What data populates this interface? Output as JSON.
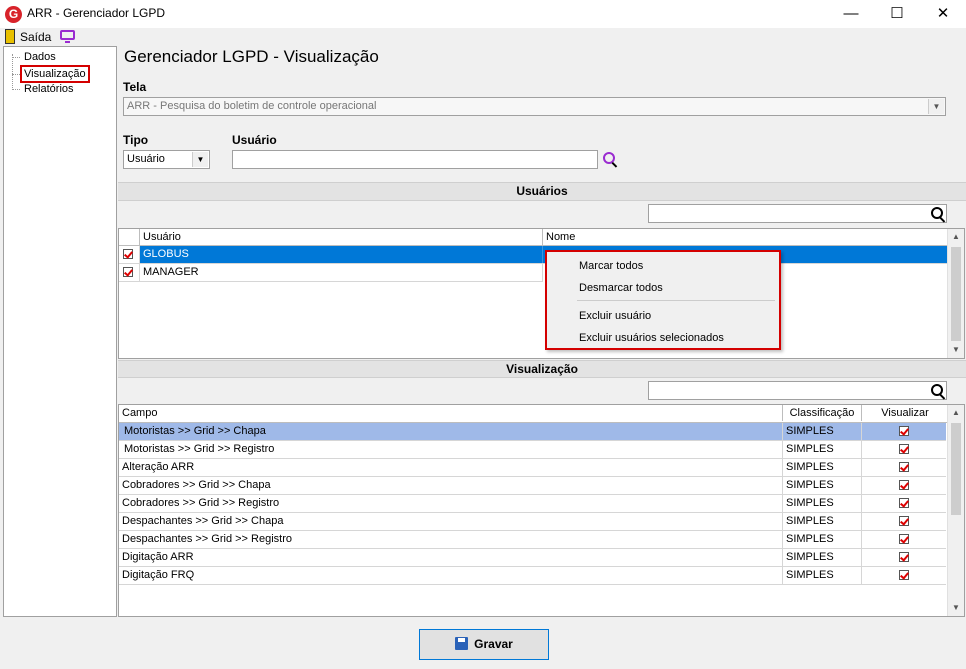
{
  "window": {
    "title": "ARR - Gerenciador LGPD",
    "app_icon_letter": "G",
    "minimize": "—",
    "maximize": "☐",
    "close": "✕"
  },
  "toolbar": {
    "exit_label": "Saída"
  },
  "tree": {
    "items": [
      "Dados",
      "Visualização",
      "Relatórios"
    ],
    "selected": "Visualização"
  },
  "main": {
    "title": "Gerenciador LGPD - Visualização",
    "tela_label": "Tela",
    "tela_value": "ARR - Pesquisa do boletim de controle operacional",
    "tipo_label": "Tipo",
    "tipo_value": "Usuário",
    "usuario_label": "Usuário",
    "usuario_value": ""
  },
  "users_section": {
    "title": "Usuários",
    "filter_value": "",
    "columns": [
      "Usuário",
      "Nome"
    ],
    "rows": [
      {
        "checked": true,
        "user": "GLOBUS",
        "name": "",
        "selected": true
      },
      {
        "checked": true,
        "user": "MANAGER",
        "name": "",
        "selected": false
      }
    ]
  },
  "context_menu": {
    "items": [
      "Marcar todos",
      "Desmarcar todos",
      "Excluir usuário",
      "Excluir usuários selecionados"
    ]
  },
  "view_section": {
    "title": "Visualização",
    "filter_value": "",
    "columns": [
      "Campo",
      "Classificação",
      "Visualizar"
    ],
    "rows": [
      {
        "field": "Motoristas >> Grid >> Chapa",
        "class": "SIMPLES",
        "visible": true,
        "selected": true
      },
      {
        "field": "Motoristas >> Grid >> Registro",
        "class": "SIMPLES",
        "visible": true,
        "selected": false
      },
      {
        "field": "Alteração ARR",
        "class": "SIMPLES",
        "visible": true,
        "selected": false
      },
      {
        "field": "Cobradores >> Grid >> Chapa",
        "class": "SIMPLES",
        "visible": true,
        "selected": false
      },
      {
        "field": "Cobradores >> Grid >> Registro",
        "class": "SIMPLES",
        "visible": true,
        "selected": false
      },
      {
        "field": "Despachantes >> Grid >> Chapa",
        "class": "SIMPLES",
        "visible": true,
        "selected": false
      },
      {
        "field": "Despachantes >> Grid >> Registro",
        "class": "SIMPLES",
        "visible": true,
        "selected": false
      },
      {
        "field": "Digitação ARR",
        "class": "SIMPLES",
        "visible": true,
        "selected": false
      },
      {
        "field": "Digitação FRQ",
        "class": "SIMPLES",
        "visible": true,
        "selected": false
      }
    ]
  },
  "save_label": "Gravar",
  "colors": {
    "selected_row_user": "#0078d7",
    "selected_row_view": "#9fb9e8",
    "highlight_border": "#d40000"
  }
}
